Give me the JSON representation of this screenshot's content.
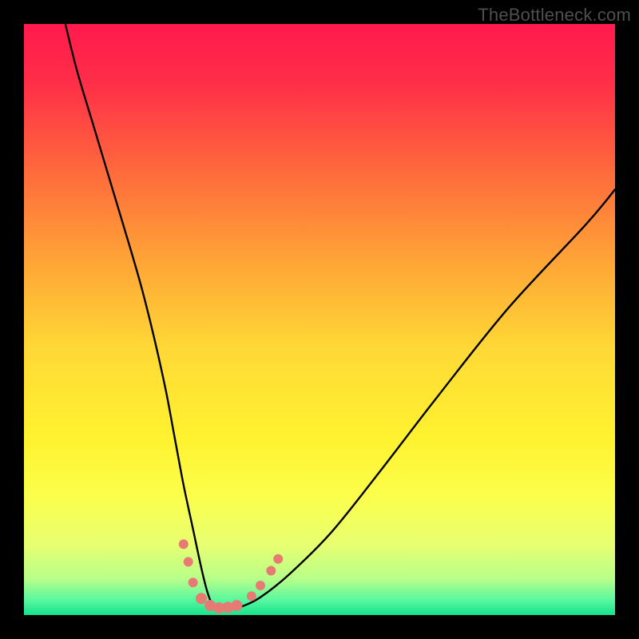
{
  "watermark": "TheBottleneck.com",
  "chart_data": {
    "type": "line",
    "title": "",
    "xlabel": "",
    "ylabel": "",
    "xlim": [
      0,
      100
    ],
    "ylim": [
      0,
      100
    ],
    "gradient_stops": [
      {
        "pos": 0.0,
        "color": "#ff1a4c"
      },
      {
        "pos": 0.1,
        "color": "#ff2e48"
      },
      {
        "pos": 0.25,
        "color": "#ff6a3c"
      },
      {
        "pos": 0.4,
        "color": "#ffa436"
      },
      {
        "pos": 0.55,
        "color": "#ffd936"
      },
      {
        "pos": 0.7,
        "color": "#fff22f"
      },
      {
        "pos": 0.8,
        "color": "#fbff4c"
      },
      {
        "pos": 0.88,
        "color": "#e8ff70"
      },
      {
        "pos": 0.94,
        "color": "#b6ff8a"
      },
      {
        "pos": 0.975,
        "color": "#57f7a0"
      },
      {
        "pos": 1.0,
        "color": "#17e38c"
      }
    ],
    "series": [
      {
        "name": "bottleneck-curve",
        "x": [
          7,
          9,
          12,
          15,
          18,
          20,
          22,
          24,
          25.5,
          27,
          28.5,
          30,
          31,
          32,
          33,
          35,
          37,
          40,
          45,
          52,
          60,
          70,
          82,
          95,
          100
        ],
        "y": [
          100,
          92,
          82,
          72,
          62,
          55,
          47,
          38,
          30,
          22,
          15,
          8,
          4,
          1.5,
          1,
          1,
          1.5,
          3,
          7,
          14,
          24,
          37,
          52,
          66,
          72
        ]
      }
    ],
    "markers": {
      "name": "highlighted-points",
      "color": "#e77b74",
      "points": [
        {
          "x": 27.0,
          "y": 12.0,
          "r": 6
        },
        {
          "x": 27.8,
          "y": 9.0,
          "r": 6
        },
        {
          "x": 28.6,
          "y": 5.5,
          "r": 6
        },
        {
          "x": 30.0,
          "y": 2.8,
          "r": 7
        },
        {
          "x": 31.5,
          "y": 1.6,
          "r": 7
        },
        {
          "x": 33.0,
          "y": 1.2,
          "r": 7
        },
        {
          "x": 34.5,
          "y": 1.3,
          "r": 7
        },
        {
          "x": 36.0,
          "y": 1.6,
          "r": 7
        },
        {
          "x": 38.5,
          "y": 3.2,
          "r": 6
        },
        {
          "x": 40.0,
          "y": 5.0,
          "r": 6
        },
        {
          "x": 41.8,
          "y": 7.5,
          "r": 6
        },
        {
          "x": 43.0,
          "y": 9.5,
          "r": 6
        }
      ]
    }
  }
}
